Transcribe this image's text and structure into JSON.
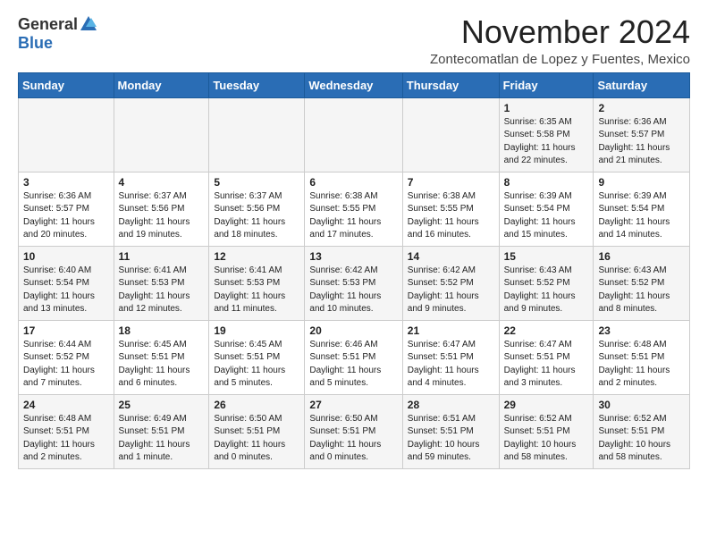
{
  "header": {
    "logo_general": "General",
    "logo_blue": "Blue",
    "month_title": "November 2024",
    "subtitle": "Zontecomatlan de Lopez y Fuentes, Mexico"
  },
  "weekdays": [
    "Sunday",
    "Monday",
    "Tuesday",
    "Wednesday",
    "Thursday",
    "Friday",
    "Saturday"
  ],
  "weeks": [
    [
      {
        "day": "",
        "info": ""
      },
      {
        "day": "",
        "info": ""
      },
      {
        "day": "",
        "info": ""
      },
      {
        "day": "",
        "info": ""
      },
      {
        "day": "",
        "info": ""
      },
      {
        "day": "1",
        "info": "Sunrise: 6:35 AM\nSunset: 5:58 PM\nDaylight: 11 hours\nand 22 minutes."
      },
      {
        "day": "2",
        "info": "Sunrise: 6:36 AM\nSunset: 5:57 PM\nDaylight: 11 hours\nand 21 minutes."
      }
    ],
    [
      {
        "day": "3",
        "info": "Sunrise: 6:36 AM\nSunset: 5:57 PM\nDaylight: 11 hours\nand 20 minutes."
      },
      {
        "day": "4",
        "info": "Sunrise: 6:37 AM\nSunset: 5:56 PM\nDaylight: 11 hours\nand 19 minutes."
      },
      {
        "day": "5",
        "info": "Sunrise: 6:37 AM\nSunset: 5:56 PM\nDaylight: 11 hours\nand 18 minutes."
      },
      {
        "day": "6",
        "info": "Sunrise: 6:38 AM\nSunset: 5:55 PM\nDaylight: 11 hours\nand 17 minutes."
      },
      {
        "day": "7",
        "info": "Sunrise: 6:38 AM\nSunset: 5:55 PM\nDaylight: 11 hours\nand 16 minutes."
      },
      {
        "day": "8",
        "info": "Sunrise: 6:39 AM\nSunset: 5:54 PM\nDaylight: 11 hours\nand 15 minutes."
      },
      {
        "day": "9",
        "info": "Sunrise: 6:39 AM\nSunset: 5:54 PM\nDaylight: 11 hours\nand 14 minutes."
      }
    ],
    [
      {
        "day": "10",
        "info": "Sunrise: 6:40 AM\nSunset: 5:54 PM\nDaylight: 11 hours\nand 13 minutes."
      },
      {
        "day": "11",
        "info": "Sunrise: 6:41 AM\nSunset: 5:53 PM\nDaylight: 11 hours\nand 12 minutes."
      },
      {
        "day": "12",
        "info": "Sunrise: 6:41 AM\nSunset: 5:53 PM\nDaylight: 11 hours\nand 11 minutes."
      },
      {
        "day": "13",
        "info": "Sunrise: 6:42 AM\nSunset: 5:53 PM\nDaylight: 11 hours\nand 10 minutes."
      },
      {
        "day": "14",
        "info": "Sunrise: 6:42 AM\nSunset: 5:52 PM\nDaylight: 11 hours\nand 9 minutes."
      },
      {
        "day": "15",
        "info": "Sunrise: 6:43 AM\nSunset: 5:52 PM\nDaylight: 11 hours\nand 9 minutes."
      },
      {
        "day": "16",
        "info": "Sunrise: 6:43 AM\nSunset: 5:52 PM\nDaylight: 11 hours\nand 8 minutes."
      }
    ],
    [
      {
        "day": "17",
        "info": "Sunrise: 6:44 AM\nSunset: 5:52 PM\nDaylight: 11 hours\nand 7 minutes."
      },
      {
        "day": "18",
        "info": "Sunrise: 6:45 AM\nSunset: 5:51 PM\nDaylight: 11 hours\nand 6 minutes."
      },
      {
        "day": "19",
        "info": "Sunrise: 6:45 AM\nSunset: 5:51 PM\nDaylight: 11 hours\nand 5 minutes."
      },
      {
        "day": "20",
        "info": "Sunrise: 6:46 AM\nSunset: 5:51 PM\nDaylight: 11 hours\nand 5 minutes."
      },
      {
        "day": "21",
        "info": "Sunrise: 6:47 AM\nSunset: 5:51 PM\nDaylight: 11 hours\nand 4 minutes."
      },
      {
        "day": "22",
        "info": "Sunrise: 6:47 AM\nSunset: 5:51 PM\nDaylight: 11 hours\nand 3 minutes."
      },
      {
        "day": "23",
        "info": "Sunrise: 6:48 AM\nSunset: 5:51 PM\nDaylight: 11 hours\nand 2 minutes."
      }
    ],
    [
      {
        "day": "24",
        "info": "Sunrise: 6:48 AM\nSunset: 5:51 PM\nDaylight: 11 hours\nand 2 minutes."
      },
      {
        "day": "25",
        "info": "Sunrise: 6:49 AM\nSunset: 5:51 PM\nDaylight: 11 hours\nand 1 minute."
      },
      {
        "day": "26",
        "info": "Sunrise: 6:50 AM\nSunset: 5:51 PM\nDaylight: 11 hours\nand 0 minutes."
      },
      {
        "day": "27",
        "info": "Sunrise: 6:50 AM\nSunset: 5:51 PM\nDaylight: 11 hours\nand 0 minutes."
      },
      {
        "day": "28",
        "info": "Sunrise: 6:51 AM\nSunset: 5:51 PM\nDaylight: 10 hours\nand 59 minutes."
      },
      {
        "day": "29",
        "info": "Sunrise: 6:52 AM\nSunset: 5:51 PM\nDaylight: 10 hours\nand 58 minutes."
      },
      {
        "day": "30",
        "info": "Sunrise: 6:52 AM\nSunset: 5:51 PM\nDaylight: 10 hours\nand 58 minutes."
      }
    ]
  ]
}
